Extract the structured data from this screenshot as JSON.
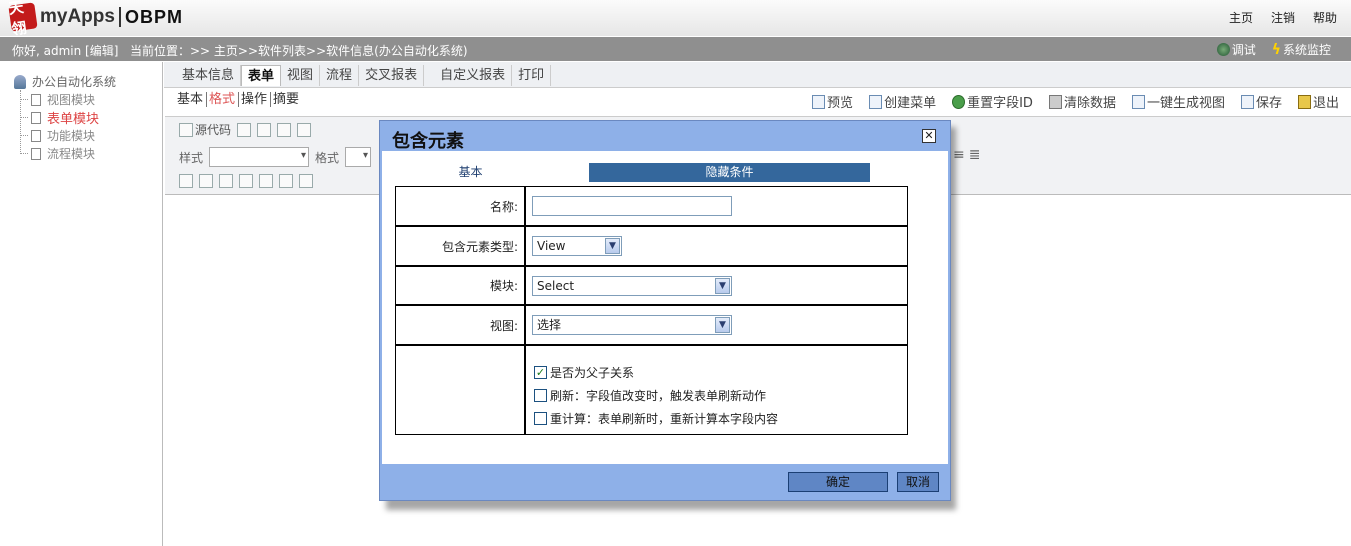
{
  "header": {
    "logo_mark": "天翎",
    "app_name": "myApps",
    "brand": "OBPM",
    "links": [
      "主页",
      "注销",
      "帮助"
    ]
  },
  "infobar": {
    "greeting": "你好, admin [编辑]",
    "breadcrumb": "当前位置：>> 主页>>软件列表>>软件信息(办公自动化系统)",
    "tools": [
      {
        "label": "调试",
        "icon": "bug-icon"
      },
      {
        "label": "系统监控",
        "icon": "lightning-icon"
      }
    ]
  },
  "sidebar": {
    "root": "办公自动化系统",
    "items": [
      {
        "label": "视图模块",
        "active": false
      },
      {
        "label": "表单模块",
        "active": true
      },
      {
        "label": "功能模块",
        "active": false
      },
      {
        "label": "流程模块",
        "active": false
      }
    ]
  },
  "tabs": [
    "基本信息",
    "表单",
    "视图",
    "流程",
    "交叉报表",
    "自定义报表",
    "打印"
  ],
  "active_tab": "表单",
  "subtabs": [
    "基本",
    "格式",
    "操作",
    "摘要"
  ],
  "active_subtab": "格式",
  "actions": [
    "预览",
    "创建菜单",
    "重置字段ID",
    "清除数据",
    "一键生成视图",
    "保存",
    "退出"
  ],
  "editor": {
    "source_label": "源代码",
    "style_label": "样式",
    "format_label": "格式"
  },
  "modal": {
    "title": "包含元素",
    "tab_basic": "基本",
    "tab_hidden": "隐藏条件",
    "fields": {
      "name_label": "名称:",
      "name_value": "",
      "type_label": "包含元素类型:",
      "type_value": "View",
      "module_label": "模块:",
      "module_value": "Select",
      "view_label": "视图:",
      "view_value": "选择"
    },
    "checkboxes": [
      {
        "label": "是否为父子关系",
        "checked": true
      },
      {
        "label": "刷新：字段值改变时，触发表单刷新动作",
        "checked": false
      },
      {
        "label": "重计算：表单刷新时，重新计算本字段内容",
        "checked": false
      }
    ],
    "ok_label": "确定",
    "cancel_label": "取消"
  }
}
